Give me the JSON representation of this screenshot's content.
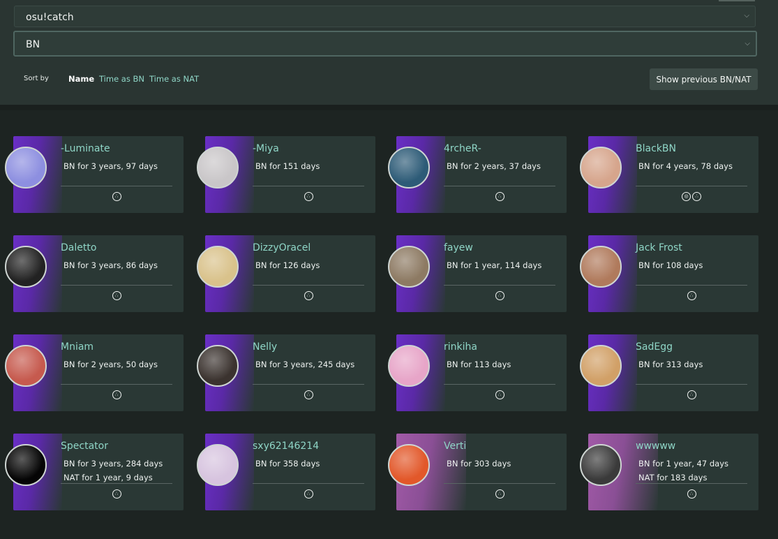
{
  "filters": {
    "mode": "osu!catch",
    "group": "BN"
  },
  "sort": {
    "label": "Sort by",
    "options": [
      "Name",
      "Time as BN",
      "Time as NAT"
    ],
    "active": "Name"
  },
  "show_previous_label": "Show previous BN/NAT",
  "cards": [
    {
      "name": "-Luminate",
      "line1": "BN for 3 years, 97 days",
      "line2": "",
      "icons": [
        "catch-mode-icon"
      ],
      "avatar_color": "#8d8fe0",
      "nat": false
    },
    {
      "name": "-Miya",
      "line1": "BN for 151 days",
      "line2": "",
      "icons": [
        "catch-mode-icon"
      ],
      "avatar_color": "#c9c6c8",
      "nat": false
    },
    {
      "name": "4rcheR-",
      "line1": "BN for 2 years, 37 days",
      "line2": "",
      "icons": [
        "catch-mode-icon"
      ],
      "avatar_color": "#2d5b77",
      "nat": false
    },
    {
      "name": "BlackBN",
      "line1": "BN for 4 years, 78 days",
      "line2": "",
      "icons": [
        "taiko-mode-icon",
        "catch-mode-icon"
      ],
      "avatar_color": "#d6a58c",
      "nat": false
    },
    {
      "name": "Daletto",
      "line1": "BN for 3 years, 86 days",
      "line2": "",
      "icons": [
        "catch-mode-icon"
      ],
      "avatar_color": "#222222",
      "nat": false
    },
    {
      "name": "DizzyOracel",
      "line1": "BN for 126 days",
      "line2": "",
      "icons": [
        "catch-mode-icon"
      ],
      "avatar_color": "#d9c28b",
      "nat": false
    },
    {
      "name": "fayew",
      "line1": "BN for 1 year, 114 days",
      "line2": "",
      "icons": [
        "catch-mode-icon"
      ],
      "avatar_color": "#8d7a63",
      "nat": false
    },
    {
      "name": "Jack Frost",
      "line1": "BN for 108 days",
      "line2": "",
      "icons": [
        "catch-mode-icon"
      ],
      "avatar_color": "#b07a5c",
      "nat": false
    },
    {
      "name": "Mniam",
      "line1": "BN for 2 years, 50 days",
      "line2": "",
      "icons": [
        "catch-mode-icon"
      ],
      "avatar_color": "#c65a4e",
      "nat": false
    },
    {
      "name": "Nelly",
      "line1": "BN for 3 years, 245 days",
      "line2": "",
      "icons": [
        "catch-mode-icon"
      ],
      "avatar_color": "#3b332f",
      "nat": false
    },
    {
      "name": "rinkiha",
      "line1": "BN for 113 days",
      "line2": "",
      "icons": [
        "catch-mode-icon"
      ],
      "avatar_color": "#e7a5c8",
      "nat": false
    },
    {
      "name": "SadEgg",
      "line1": "BN for 313 days",
      "line2": "",
      "icons": [
        "catch-mode-icon"
      ],
      "avatar_color": "#d1a067",
      "nat": false
    },
    {
      "name": "Spectator",
      "line1": "BN for 3 years, 284 days",
      "line2": "NAT for 1 year, 9 days",
      "icons": [
        "catch-mode-icon"
      ],
      "avatar_color": "#050505",
      "nat": false
    },
    {
      "name": "sxy62146214",
      "line1": "BN for 358 days",
      "line2": "",
      "icons": [
        "catch-mode-icon"
      ],
      "avatar_color": "#d7c4df",
      "nat": false
    },
    {
      "name": "Verti",
      "line1": "BN for 303 days",
      "line2": "",
      "icons": [
        "catch-mode-icon"
      ],
      "avatar_color": "#e2582a",
      "nat": true
    },
    {
      "name": "wwwww",
      "line1": "BN for 1 year, 47 days",
      "line2": "NAT for 183 days",
      "icons": [
        "catch-mode-icon"
      ],
      "avatar_color": "#3a3a3a",
      "nat": true
    }
  ]
}
